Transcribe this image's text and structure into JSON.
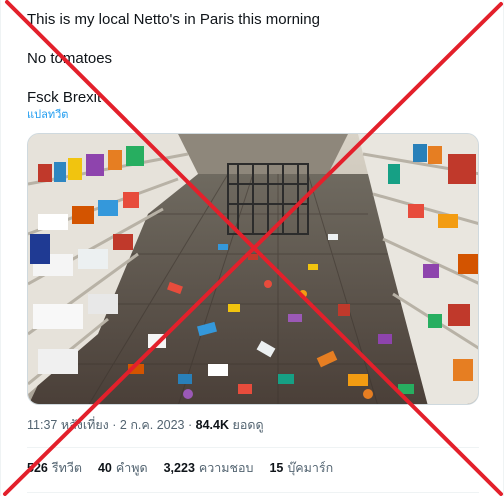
{
  "tweet": {
    "lines": [
      "This is my local Netto's in Paris this morning",
      "No tomatoes",
      "Fsck Brexit"
    ],
    "translate_label": "แปลทวีต"
  },
  "meta": {
    "time": "11:37 หลังเที่ยง",
    "date": "2 ก.ค. 2023",
    "views_count": "84.4K",
    "views_label": "ยอดดู",
    "separator": "·"
  },
  "stats": {
    "retweets": {
      "count": "526",
      "label": "รีทวีต"
    },
    "quotes": {
      "count": "40",
      "label": "คำพูด"
    },
    "likes": {
      "count": "3,223",
      "label": "ความชอบ"
    },
    "bookmarks": {
      "count": "15",
      "label": "บุ๊คมาร์ก"
    }
  },
  "overlay": {
    "cross_color": "#e3202b"
  },
  "colors": {
    "link": "#1d9bf0",
    "secondary_text": "#536471",
    "primary_text": "#0f1419"
  }
}
